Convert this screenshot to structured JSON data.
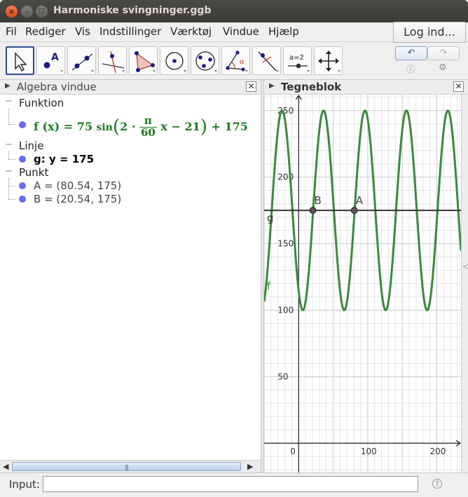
{
  "window": {
    "title": "Harmoniske svingninger.ggb"
  },
  "menu": {
    "items": [
      "Fil",
      "Rediger",
      "Vis",
      "Indstillinger",
      "Værktøj",
      "Vindue",
      "Hjælp"
    ],
    "login_label": "Log ind..."
  },
  "toolbar": {
    "tools": [
      "move-tool",
      "point-tool",
      "line-tool",
      "perpendicular-tool",
      "polygon-tool",
      "circle-tool",
      "conic-tool",
      "angle-tool",
      "reflect-tool",
      "slider-tool",
      "move-view-tool"
    ],
    "slider_label": "a=2",
    "point_label": "A",
    "angle_label": "α"
  },
  "algebra": {
    "title": "Algebra vindue",
    "groups": [
      {
        "label": "Funktion"
      },
      {
        "label": "Linje"
      },
      {
        "label": "Punkt"
      }
    ],
    "function": {
      "lhs": "f (x)",
      "eq": "=",
      "amp": "75",
      "fn": "sin",
      "two": "2",
      "dot": "·",
      "pi": "π",
      "den": "60",
      "rest": "x − 21",
      "close": ")",
      "plus": "+ 175"
    },
    "line_obj": "g: y = 175",
    "point_a": "A = (80.54, 175)",
    "point_b": "B = (20.54, 175)"
  },
  "graphics": {
    "title": "Tegneblok",
    "accent": "#3a8a3a",
    "line_color": "#333333",
    "point_color": "#555555"
  },
  "chart_data": {
    "type": "line",
    "function": "f(x) = 75 sin(2·π/60 (x − 21)) + 175",
    "amplitude": 75,
    "period": 60,
    "phase": 21,
    "offset": 175,
    "line_y": 175,
    "points": [
      {
        "name": "A",
        "x": 80.54,
        "y": 175
      },
      {
        "name": "B",
        "x": 20.54,
        "y": 175
      }
    ],
    "labels": {
      "f": "f",
      "g": "g"
    },
    "xlim": [
      -50,
      235
    ],
    "ylim": [
      -22,
      262
    ],
    "x_ticks": [
      "0",
      "100",
      "200"
    ],
    "y_ticks": [
      "50",
      "100",
      "150",
      "200",
      "250"
    ],
    "grid": true
  },
  "input": {
    "label": "Input:",
    "value": "",
    "help": "?"
  }
}
